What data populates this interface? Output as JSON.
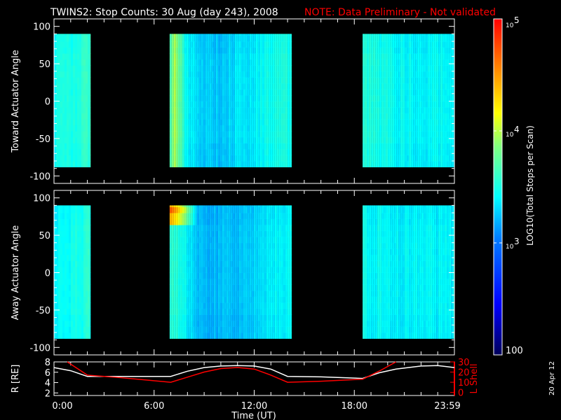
{
  "title": "TWINS2: Stop Counts: 30 Aug (day 243), 2008",
  "note": "NOTE: Data Preliminary - Not validated",
  "date_stamp": "20 Apr 12",
  "colors": {
    "note": "#ff0000",
    "lshell": "#ff0000",
    "r_line": "#ffffff",
    "axes": "#ffffff"
  },
  "chart_data": [
    {
      "type": "heatmap",
      "name": "toward",
      "ylabel": "Toward Actuator Angle",
      "ylim": [
        -110,
        110
      ],
      "yticks": [
        {
          "v": 100,
          "label": "100"
        },
        {
          "v": 50,
          "label": "50"
        },
        {
          "v": 0,
          "label": "0"
        },
        {
          "v": -50,
          "label": "-50"
        },
        {
          "v": -100,
          "label": "-100"
        }
      ],
      "xlim": [
        0,
        24
      ],
      "data_angle_range": [
        -88,
        90
      ],
      "blocks": [
        {
          "start": 0,
          "end": 2.2,
          "profile": [
            [
              0,
              3.45
            ],
            [
              1,
              3.5
            ],
            [
              2.2,
              3.6
            ]
          ]
        },
        {
          "start": 6.93,
          "end": 14.25,
          "profile": [
            [
              6.93,
              3.7
            ],
            [
              7.2,
              3.95
            ],
            [
              7.5,
              3.75
            ],
            [
              7.8,
              3.45
            ],
            [
              8.5,
              3.3
            ],
            [
              9.5,
              3.25
            ],
            [
              10.5,
              3.3
            ],
            [
              12,
              3.4
            ],
            [
              13,
              3.45
            ],
            [
              14.25,
              3.5
            ]
          ]
        },
        {
          "start": 18.5,
          "end": 24,
          "profile": [
            [
              18.5,
              3.55
            ],
            [
              20,
              3.45
            ],
            [
              22,
              3.4
            ],
            [
              24,
              3.45
            ]
          ]
        }
      ],
      "hotspots": []
    },
    {
      "type": "heatmap",
      "name": "away",
      "ylabel": "Away Actuator Angle",
      "ylim": [
        -110,
        110
      ],
      "yticks": [
        {
          "v": 100,
          "label": "100"
        },
        {
          "v": 50,
          "label": "50"
        },
        {
          "v": 0,
          "label": "0"
        },
        {
          "v": -50,
          "label": "-50"
        },
        {
          "v": -100,
          "label": "-100"
        }
      ],
      "xlim": [
        0,
        24
      ],
      "data_angle_range": [
        -88,
        90
      ],
      "blocks": [
        {
          "start": 0,
          "end": 2.2,
          "profile": [
            [
              0,
              3.4
            ],
            [
              1,
              3.45
            ],
            [
              2.2,
              3.55
            ]
          ]
        },
        {
          "start": 6.93,
          "end": 14.25,
          "profile": [
            [
              6.93,
              3.55
            ],
            [
              7.5,
              3.5
            ],
            [
              8,
              3.35
            ],
            [
              9,
              3.2
            ],
            [
              10.5,
              3.25
            ],
            [
              12,
              3.3
            ],
            [
              13,
              3.35
            ],
            [
              14.25,
              3.45
            ]
          ]
        },
        {
          "start": 18.5,
          "end": 24,
          "profile": [
            [
              18.5,
              3.45
            ],
            [
              20,
              3.4
            ],
            [
              22,
              3.4
            ],
            [
              24,
              3.4
            ]
          ]
        }
      ],
      "hotspots": [
        {
          "t0": 6.93,
          "t1": 8.5,
          "a0": 68,
          "a1": 90,
          "peak": 4.7
        }
      ]
    },
    {
      "type": "line",
      "name": "orbit",
      "xlabel": "Time (UT)",
      "xticks": [
        {
          "v": 0,
          "label": "0:00"
        },
        {
          "v": 6,
          "label": "6:00"
        },
        {
          "v": 12,
          "label": "12:00"
        },
        {
          "v": 18,
          "label": "18:00"
        },
        {
          "v": 24,
          "label": "23:59"
        }
      ],
      "xlim": [
        0,
        24
      ],
      "left_axis": {
        "label": "R [RE]",
        "ylim": [
          1.5,
          8
        ],
        "ticks": [
          {
            "v": 2,
            "label": "2"
          },
          {
            "v": 4,
            "label": "4"
          },
          {
            "v": 6,
            "label": "6"
          },
          {
            "v": 8,
            "label": "8"
          }
        ]
      },
      "right_axis": {
        "label": "L Shell",
        "ylim": [
          -3,
          30
        ],
        "ticks": [
          {
            "v": 0,
            "label": "0"
          },
          {
            "v": 10,
            "label": "10"
          },
          {
            "v": 20,
            "label": "20"
          },
          {
            "v": 30,
            "label": "30"
          }
        ]
      },
      "series": [
        {
          "name": "R",
          "axis": "left",
          "x": [
            0,
            1,
            2,
            4,
            7,
            8,
            9,
            10,
            11,
            12,
            13,
            14,
            16,
            18.5,
            19.5,
            20.5,
            22,
            23,
            24
          ],
          "y": [
            6.9,
            6.3,
            5.2,
            5.2,
            5.2,
            6.2,
            6.9,
            7.2,
            7.3,
            7.2,
            6.6,
            5.2,
            5.1,
            4.8,
            5.9,
            6.6,
            7.2,
            7.3,
            6.9
          ]
        },
        {
          "name": "L Shell",
          "axis": "right",
          "x": [
            0.8,
            2,
            4,
            7,
            8,
            9,
            10,
            11,
            12,
            13,
            14,
            16,
            18.5,
            19.5,
            20.5
          ],
          "y": [
            30,
            17,
            14.5,
            10,
            15,
            20,
            23.5,
            24.5,
            23,
            17,
            10,
            11,
            13,
            21,
            30
          ]
        }
      ]
    }
  ],
  "colorbar": {
    "label": "LOG10(Total Stops per Scan)",
    "range_log": [
      2,
      5
    ],
    "ticks": [
      {
        "v": 5,
        "label": "10",
        "exp": "5"
      },
      {
        "v": 4,
        "label": "10",
        "exp": "4"
      },
      {
        "v": 3,
        "label": "10",
        "exp": "3"
      },
      {
        "v": 2,
        "label": "100",
        "exp": ""
      }
    ]
  }
}
